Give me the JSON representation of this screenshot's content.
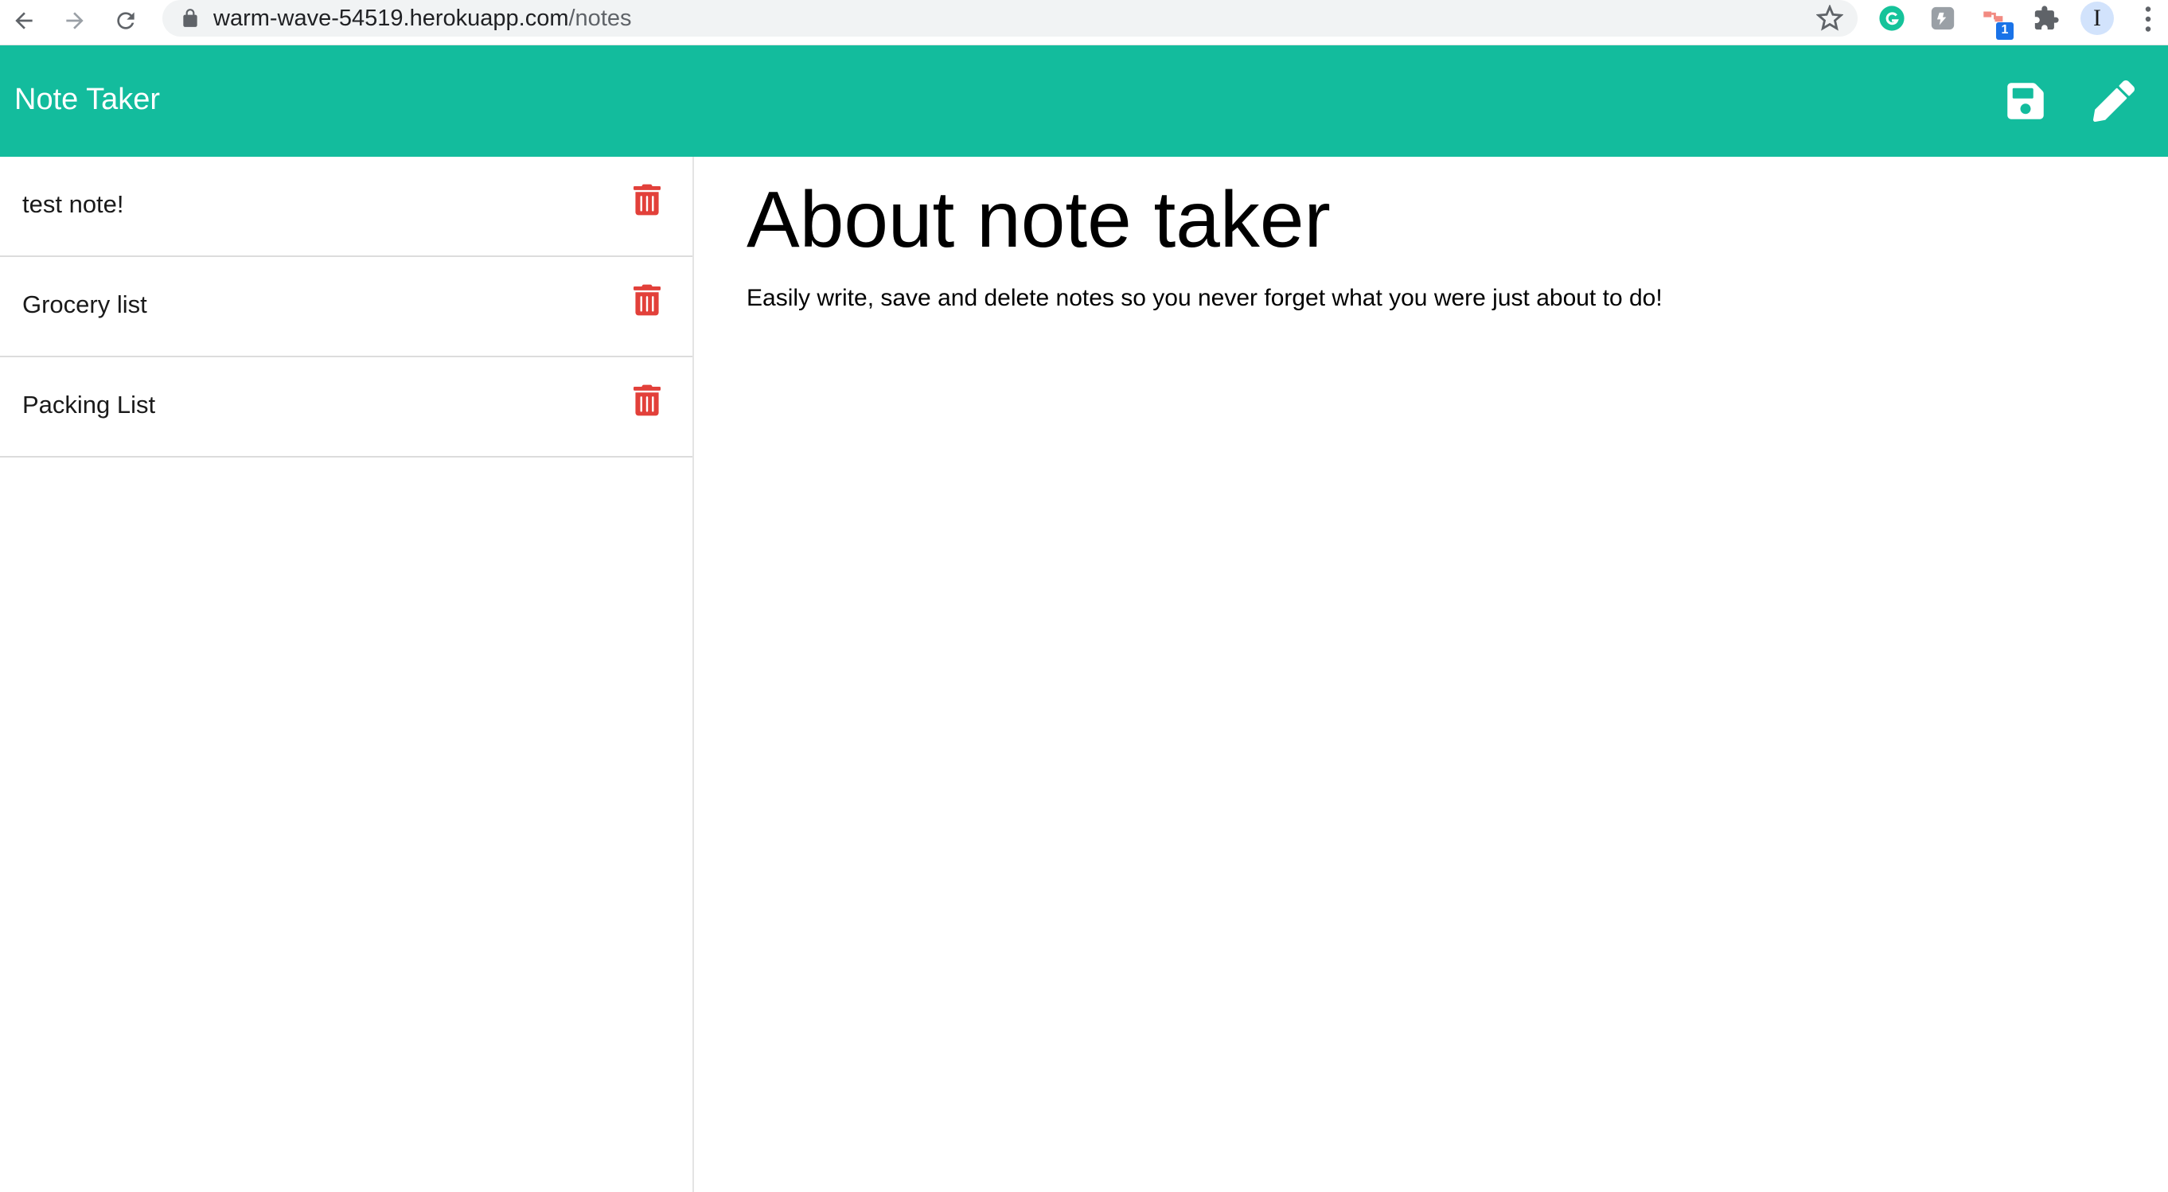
{
  "browser": {
    "url_host": "warm-wave-54519.herokuapp.com",
    "url_path": "/notes",
    "extension_badge": "1",
    "profile_initial": "I",
    "icons": [
      "back-icon",
      "forward-icon",
      "reload-icon",
      "lock-icon",
      "star-icon",
      "grammarly-icon",
      "extension-icon",
      "extension-icon",
      "puzzle-icon",
      "profile-icon",
      "more-icon"
    ]
  },
  "app": {
    "brand": "Note Taker",
    "accent_color": "#13bc9d",
    "delete_color": "#e2403a",
    "actions": [
      {
        "name": "save",
        "icon": "save-icon"
      },
      {
        "name": "new-note",
        "icon": "pencil-icon"
      }
    ]
  },
  "notes": [
    {
      "title": "test note!"
    },
    {
      "title": "Grocery list"
    },
    {
      "title": "Packing List"
    }
  ],
  "active_note": {
    "title": "About note taker",
    "text": "Easily write, save and delete notes so you never forget what you were just about to do!"
  }
}
